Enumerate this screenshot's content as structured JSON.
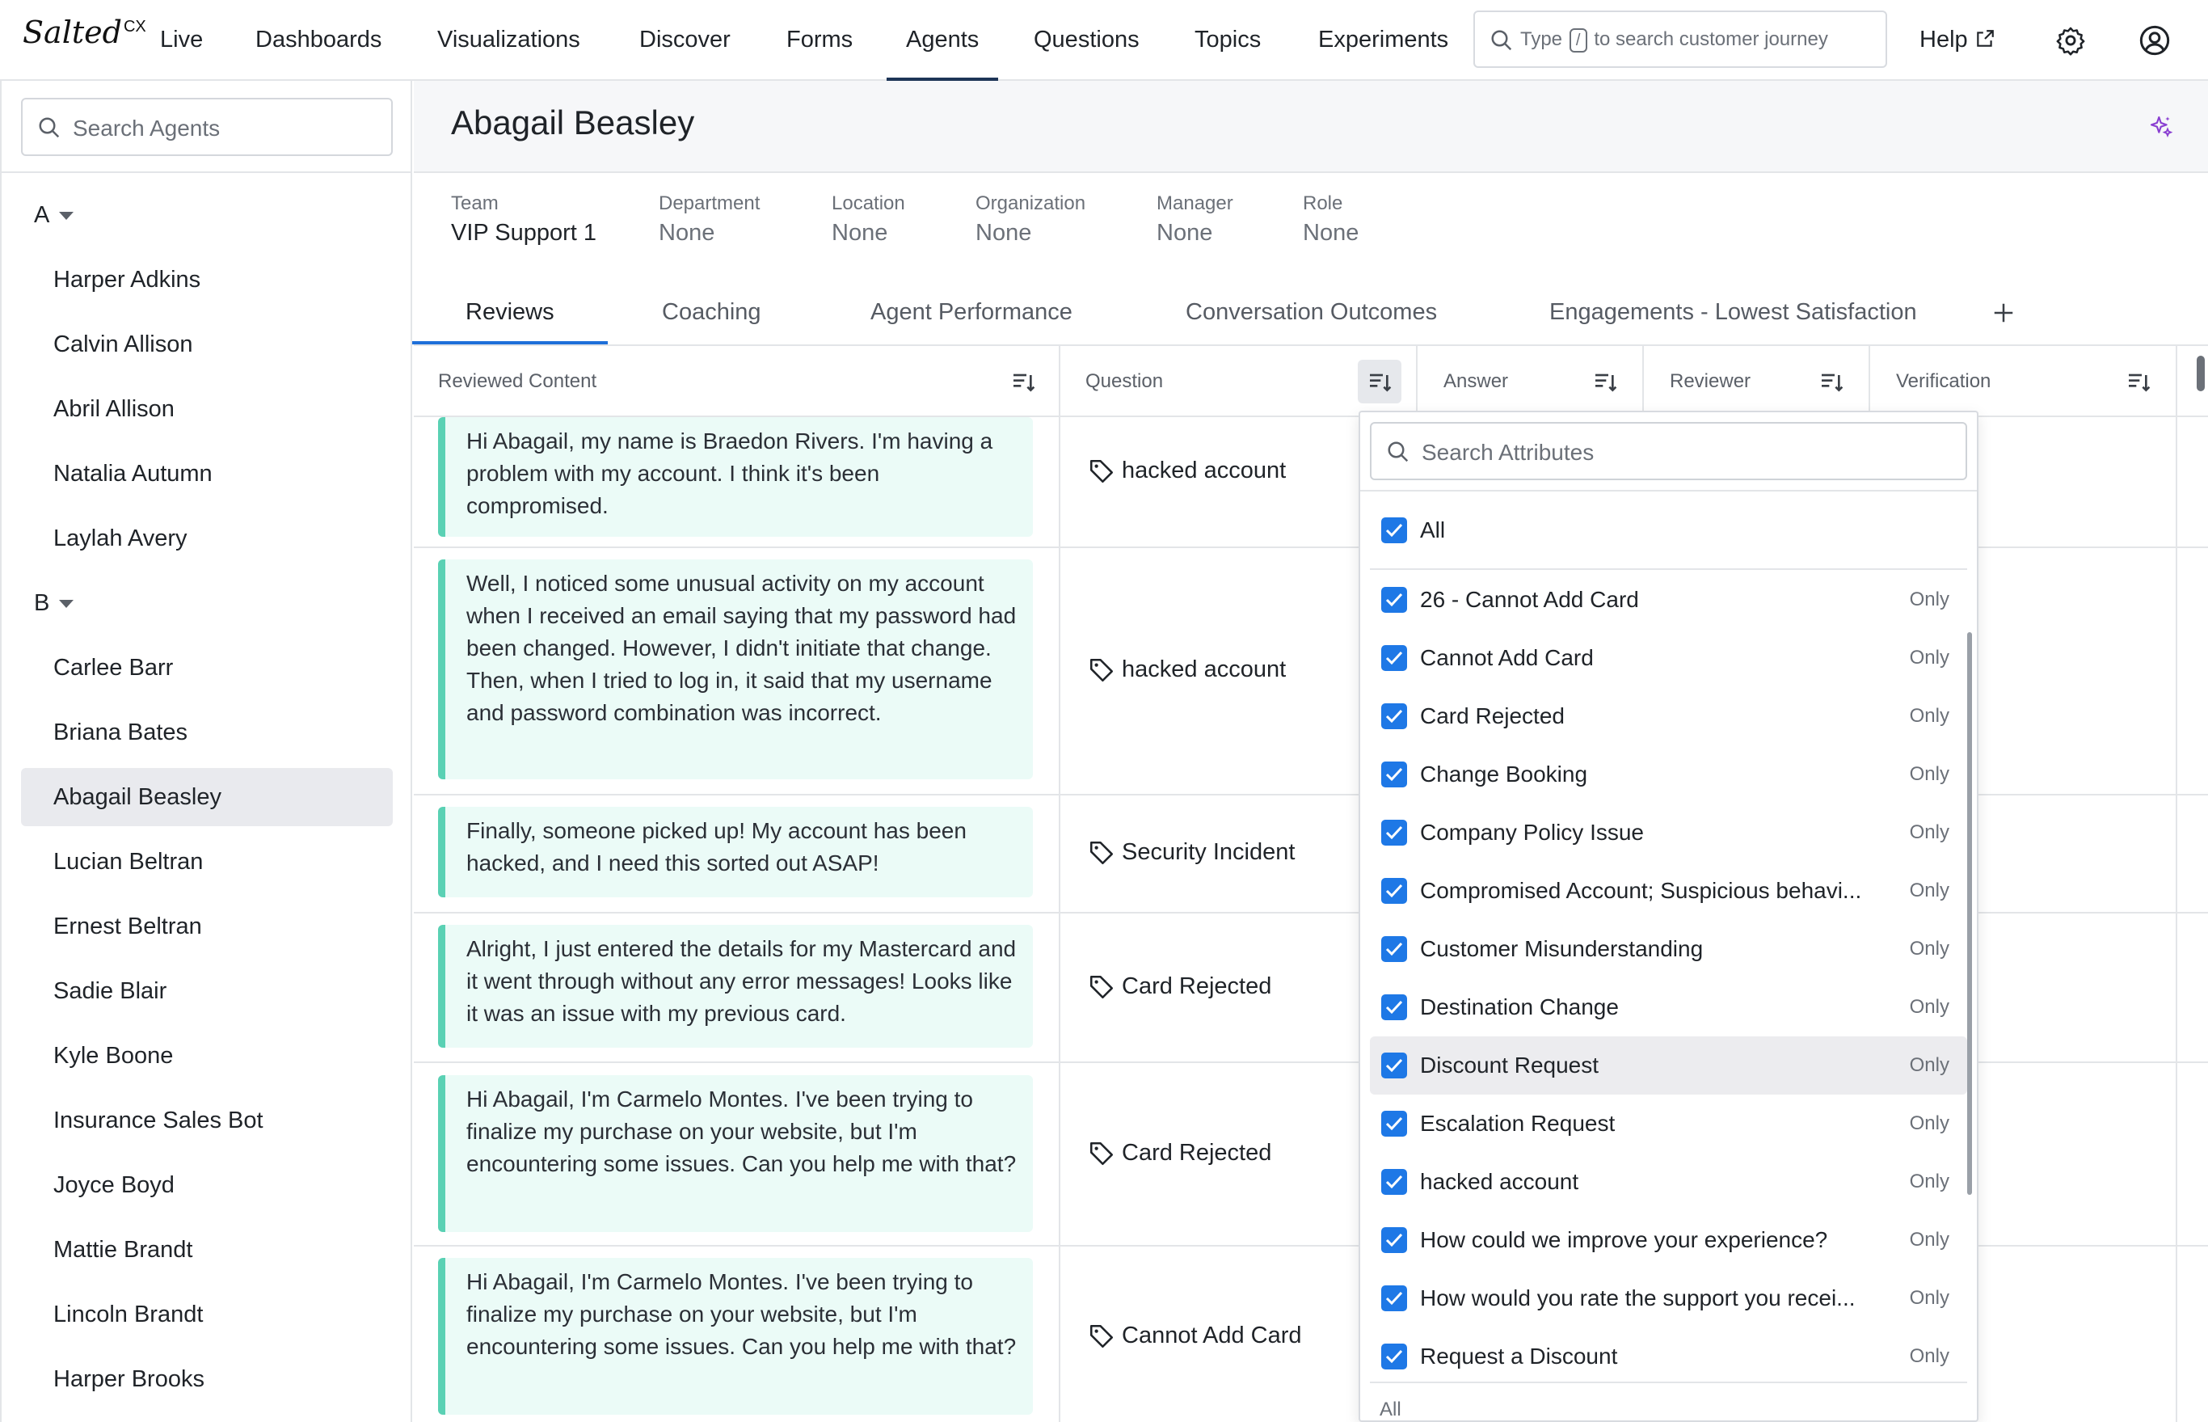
{
  "app": {
    "logo": "Salted",
    "logo_sup": "CX"
  },
  "nav": {
    "items": [
      {
        "label": "Live"
      },
      {
        "label": "Dashboards"
      },
      {
        "label": "Visualizations"
      },
      {
        "label": "Discover"
      },
      {
        "label": "Forms"
      },
      {
        "label": "Agents",
        "active": true
      },
      {
        "label": "Questions"
      },
      {
        "label": "Topics"
      },
      {
        "label": "Experiments"
      }
    ],
    "search": {
      "prefix": "Type",
      "key": "/",
      "suffix": "to search customer journey"
    },
    "help": "Help"
  },
  "sidebar": {
    "search_placeholder": "Search Agents",
    "groups": [
      {
        "letter": "A",
        "agents": [
          "Harper Adkins",
          "Calvin Allison",
          "Abril Allison",
          "Natalia Autumn",
          "Laylah Avery"
        ]
      },
      {
        "letter": "B",
        "agents": [
          "Carlee Barr",
          "Briana Bates",
          "Abagail Beasley",
          "Lucian Beltran",
          "Ernest Beltran",
          "Sadie Blair",
          "Kyle Boone",
          "Insurance Sales Bot",
          "Joyce Boyd",
          "Mattie Brandt",
          "Lincoln Brandt",
          "Harper Brooks"
        ]
      }
    ],
    "selected": "Abagail Beasley"
  },
  "agent": {
    "name": "Abagail Beasley",
    "meta": [
      {
        "label": "Team",
        "value": "VIP Support 1"
      },
      {
        "label": "Department",
        "value": "None"
      },
      {
        "label": "Location",
        "value": "None"
      },
      {
        "label": "Organization",
        "value": "None"
      },
      {
        "label": "Manager",
        "value": "None"
      },
      {
        "label": "Role",
        "value": "None"
      }
    ]
  },
  "tabs": [
    {
      "label": "Reviews",
      "active": true
    },
    {
      "label": "Coaching"
    },
    {
      "label": "Agent Performance"
    },
    {
      "label": "Conversation Outcomes"
    },
    {
      "label": "Engagements - Lowest Satisfaction"
    }
  ],
  "table": {
    "columns": [
      "Reviewed Content",
      "Question",
      "Answer",
      "Reviewer",
      "Verification"
    ],
    "rows": [
      {
        "content": "Hi Abagail, my name is Braedon Rivers. I'm having a problem with my account. I think it's been compromised.",
        "question": "hacked account"
      },
      {
        "content": "Well, I noticed some unusual activity on my account when I received an email saying that my password had been changed. However, I didn't initiate that change. Then, when I tried to log in, it said that my username and password combination was incorrect.",
        "question": "hacked account"
      },
      {
        "content": "Finally, someone picked up! My account has been hacked, and I need this sorted out ASAP!",
        "question": "Security Incident"
      },
      {
        "content": "Alright, I just entered the details for my Mastercard and it went through without any error messages! Looks like it was an issue with my previous card.",
        "question": "Card Rejected"
      },
      {
        "content": "Hi Abagail, I'm Carmelo Montes. I've been trying to finalize my purchase on your website, but I'm encountering some issues. Can you help me with that?",
        "question": "Card Rejected"
      },
      {
        "content": "Hi Abagail, I'm Carmelo Montes. I've been trying to finalize my purchase on your website, but I'm encountering some issues. Can you help me with that?",
        "question": "Cannot Add Card"
      }
    ]
  },
  "filter_dropdown": {
    "search_placeholder": "Search Attributes",
    "all_label": "All",
    "only_label": "Only",
    "options": [
      "26 - Cannot Add Card",
      "Cannot Add Card",
      "Card Rejected",
      "Change Booking",
      "Company Policy Issue",
      "Compromised Account; Suspicious behavi...",
      "Customer Misunderstanding",
      "Destination Change",
      "Discount Request",
      "Escalation Request",
      "hacked account",
      "How could we improve your experience?",
      "How would you rate the support you recei...",
      "Request a Discount"
    ],
    "highlighted": "Discount Request",
    "footer": "All",
    "checkbox_color": "#1e78e6"
  },
  "colors": {
    "accent": "#1e6fd9",
    "bubble_bg": "#ebfbf7",
    "bubble_border": "#5ad1b4",
    "sparkle": "#8a3fd1"
  }
}
